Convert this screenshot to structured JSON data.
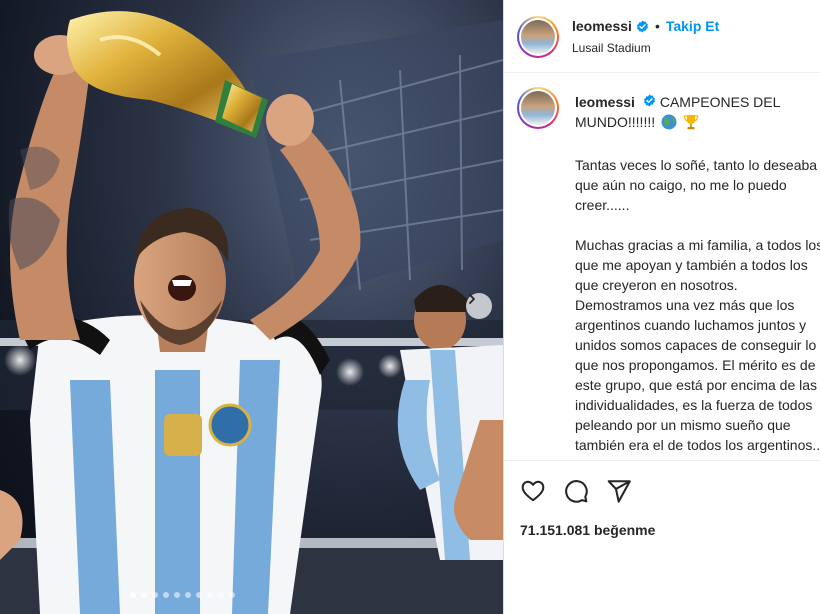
{
  "post": {
    "username": "leomessi",
    "follow_label": "Takip Et",
    "separator": "•",
    "location": "Lusail Stadium",
    "caption_title": "CAMPEONES DEL MUNDO!!!!!!!",
    "caption_paragraphs": [
      "Tantas veces lo soñé, tanto lo deseaba que aún no caigo, no me lo puedo creer......",
      "Muchas gracias a mi familia, a todos los que me apoyan y también a todos los que creyeron en nosotros. Demostramos una vez más que los argentinos cuando luchamos juntos y unidos somos capaces de conseguir lo que nos propongamos. El mérito es de este grupo, que está por encima de las individualidades, es la fuerza de todos peleando por un mismo sueño que también era el de todos los argentinos... Lo logramos!!!"
    ],
    "likes": "71.151.081 beğenme"
  },
  "icons": {
    "verified": "verified-badge-icon",
    "like": "heart-icon",
    "comment": "comment-icon",
    "share": "send-icon",
    "next": "chevron-right-icon",
    "globe": "globe-emoji-icon",
    "trophy": "trophy-emoji-icon"
  },
  "carousel": {
    "slide_count": 10,
    "active_index": 0
  },
  "colors": {
    "accent": "#0095f6",
    "text": "#262626",
    "jersey_blue": "#75aadb"
  }
}
